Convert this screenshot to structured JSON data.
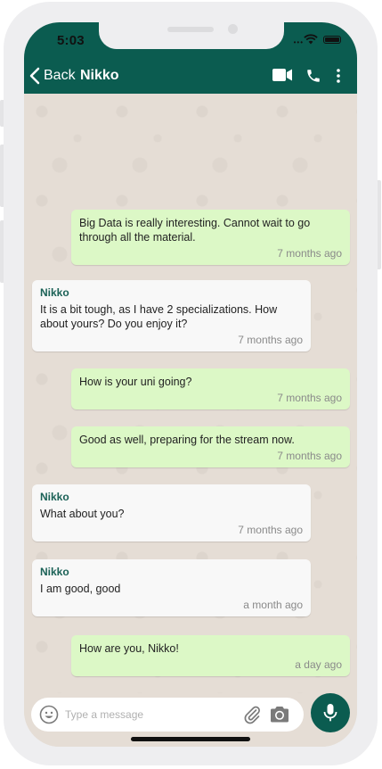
{
  "status_bar": {
    "time": "5:03"
  },
  "header": {
    "back_label": "Back",
    "contact_name": "Nikko"
  },
  "messages": [
    {
      "direction": "out",
      "text": "Big Data is really interesting. Cannot wait to go through all the material.",
      "time": "7 months ago"
    },
    {
      "direction": "in",
      "sender": "Nikko",
      "text": "It is a bit tough, as I have 2 specializations. How about yours? Do you enjoy it?",
      "time": "7 months ago"
    },
    {
      "direction": "out",
      "text": "How is your uni going?",
      "time": "7 months ago"
    },
    {
      "direction": "out",
      "text": "Good as well, preparing for the stream now.",
      "time": "7 months ago"
    },
    {
      "direction": "in",
      "sender": "Nikko",
      "text": "What about you?",
      "time": "7 months ago"
    },
    {
      "direction": "in",
      "sender": "Nikko",
      "text": "I am good, good",
      "time": "a month ago"
    },
    {
      "direction": "out",
      "text": "How are you, Nikko!",
      "time": "a day ago"
    }
  ],
  "composer": {
    "placeholder": "Type a message"
  },
  "colors": {
    "header": "#0b5c50",
    "outgoing_bubble": "#dcf8c6",
    "incoming_bubble": "#f8f8f8",
    "sender_name": "#1a6156"
  },
  "icons": [
    "chevron-left-icon",
    "video-camera-icon",
    "phone-icon",
    "more-vertical-icon",
    "emoji-icon",
    "paperclip-icon",
    "camera-icon",
    "microphone-icon"
  ]
}
